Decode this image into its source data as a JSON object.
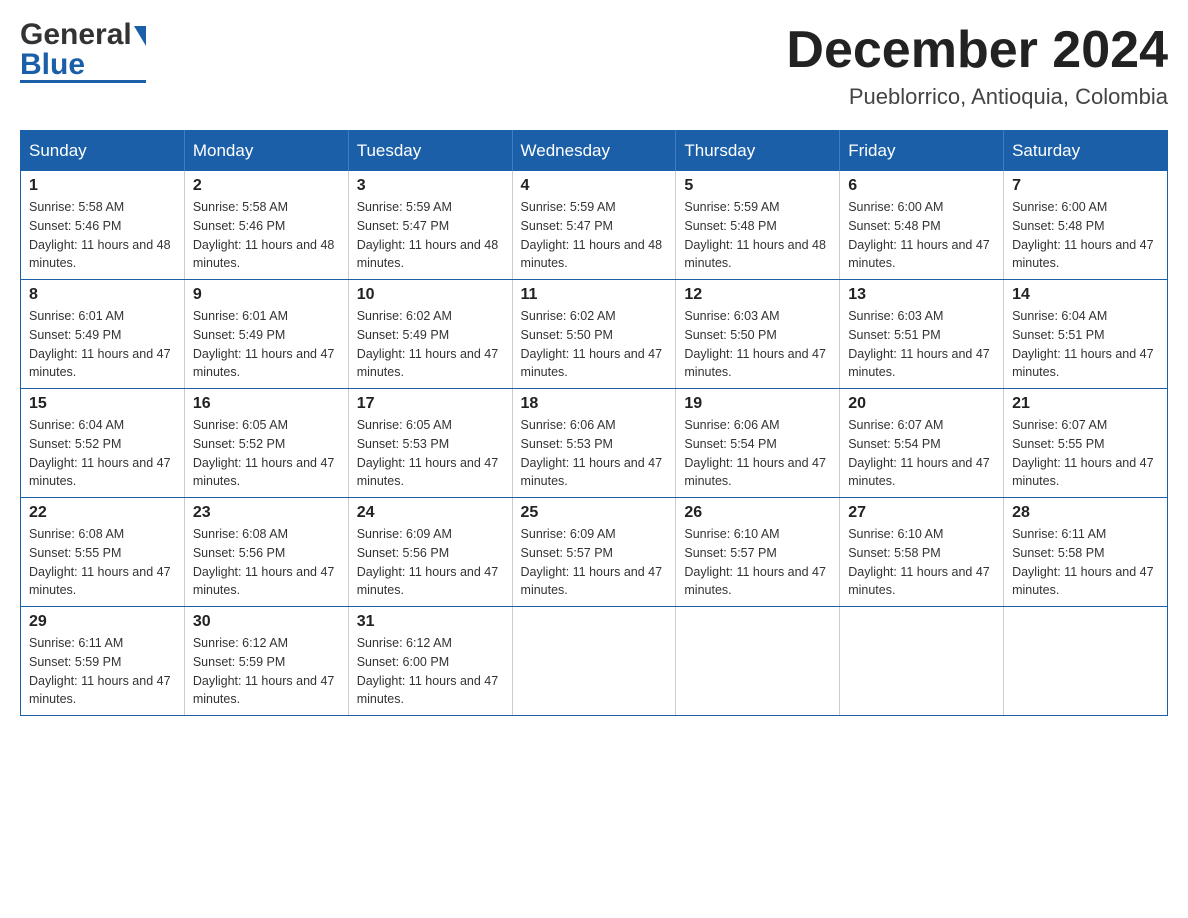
{
  "header": {
    "logo_general": "General",
    "logo_blue": "Blue",
    "month_title": "December 2024",
    "location": "Pueblorrico, Antioquia, Colombia"
  },
  "days_of_week": [
    "Sunday",
    "Monday",
    "Tuesday",
    "Wednesday",
    "Thursday",
    "Friday",
    "Saturday"
  ],
  "weeks": [
    [
      {
        "day": "1",
        "sunrise": "Sunrise: 5:58 AM",
        "sunset": "Sunset: 5:46 PM",
        "daylight": "Daylight: 11 hours and 48 minutes."
      },
      {
        "day": "2",
        "sunrise": "Sunrise: 5:58 AM",
        "sunset": "Sunset: 5:46 PM",
        "daylight": "Daylight: 11 hours and 48 minutes."
      },
      {
        "day": "3",
        "sunrise": "Sunrise: 5:59 AM",
        "sunset": "Sunset: 5:47 PM",
        "daylight": "Daylight: 11 hours and 48 minutes."
      },
      {
        "day": "4",
        "sunrise": "Sunrise: 5:59 AM",
        "sunset": "Sunset: 5:47 PM",
        "daylight": "Daylight: 11 hours and 48 minutes."
      },
      {
        "day": "5",
        "sunrise": "Sunrise: 5:59 AM",
        "sunset": "Sunset: 5:48 PM",
        "daylight": "Daylight: 11 hours and 48 minutes."
      },
      {
        "day": "6",
        "sunrise": "Sunrise: 6:00 AM",
        "sunset": "Sunset: 5:48 PM",
        "daylight": "Daylight: 11 hours and 47 minutes."
      },
      {
        "day": "7",
        "sunrise": "Sunrise: 6:00 AM",
        "sunset": "Sunset: 5:48 PM",
        "daylight": "Daylight: 11 hours and 47 minutes."
      }
    ],
    [
      {
        "day": "8",
        "sunrise": "Sunrise: 6:01 AM",
        "sunset": "Sunset: 5:49 PM",
        "daylight": "Daylight: 11 hours and 47 minutes."
      },
      {
        "day": "9",
        "sunrise": "Sunrise: 6:01 AM",
        "sunset": "Sunset: 5:49 PM",
        "daylight": "Daylight: 11 hours and 47 minutes."
      },
      {
        "day": "10",
        "sunrise": "Sunrise: 6:02 AM",
        "sunset": "Sunset: 5:49 PM",
        "daylight": "Daylight: 11 hours and 47 minutes."
      },
      {
        "day": "11",
        "sunrise": "Sunrise: 6:02 AM",
        "sunset": "Sunset: 5:50 PM",
        "daylight": "Daylight: 11 hours and 47 minutes."
      },
      {
        "day": "12",
        "sunrise": "Sunrise: 6:03 AM",
        "sunset": "Sunset: 5:50 PM",
        "daylight": "Daylight: 11 hours and 47 minutes."
      },
      {
        "day": "13",
        "sunrise": "Sunrise: 6:03 AM",
        "sunset": "Sunset: 5:51 PM",
        "daylight": "Daylight: 11 hours and 47 minutes."
      },
      {
        "day": "14",
        "sunrise": "Sunrise: 6:04 AM",
        "sunset": "Sunset: 5:51 PM",
        "daylight": "Daylight: 11 hours and 47 minutes."
      }
    ],
    [
      {
        "day": "15",
        "sunrise": "Sunrise: 6:04 AM",
        "sunset": "Sunset: 5:52 PM",
        "daylight": "Daylight: 11 hours and 47 minutes."
      },
      {
        "day": "16",
        "sunrise": "Sunrise: 6:05 AM",
        "sunset": "Sunset: 5:52 PM",
        "daylight": "Daylight: 11 hours and 47 minutes."
      },
      {
        "day": "17",
        "sunrise": "Sunrise: 6:05 AM",
        "sunset": "Sunset: 5:53 PM",
        "daylight": "Daylight: 11 hours and 47 minutes."
      },
      {
        "day": "18",
        "sunrise": "Sunrise: 6:06 AM",
        "sunset": "Sunset: 5:53 PM",
        "daylight": "Daylight: 11 hours and 47 minutes."
      },
      {
        "day": "19",
        "sunrise": "Sunrise: 6:06 AM",
        "sunset": "Sunset: 5:54 PM",
        "daylight": "Daylight: 11 hours and 47 minutes."
      },
      {
        "day": "20",
        "sunrise": "Sunrise: 6:07 AM",
        "sunset": "Sunset: 5:54 PM",
        "daylight": "Daylight: 11 hours and 47 minutes."
      },
      {
        "day": "21",
        "sunrise": "Sunrise: 6:07 AM",
        "sunset": "Sunset: 5:55 PM",
        "daylight": "Daylight: 11 hours and 47 minutes."
      }
    ],
    [
      {
        "day": "22",
        "sunrise": "Sunrise: 6:08 AM",
        "sunset": "Sunset: 5:55 PM",
        "daylight": "Daylight: 11 hours and 47 minutes."
      },
      {
        "day": "23",
        "sunrise": "Sunrise: 6:08 AM",
        "sunset": "Sunset: 5:56 PM",
        "daylight": "Daylight: 11 hours and 47 minutes."
      },
      {
        "day": "24",
        "sunrise": "Sunrise: 6:09 AM",
        "sunset": "Sunset: 5:56 PM",
        "daylight": "Daylight: 11 hours and 47 minutes."
      },
      {
        "day": "25",
        "sunrise": "Sunrise: 6:09 AM",
        "sunset": "Sunset: 5:57 PM",
        "daylight": "Daylight: 11 hours and 47 minutes."
      },
      {
        "day": "26",
        "sunrise": "Sunrise: 6:10 AM",
        "sunset": "Sunset: 5:57 PM",
        "daylight": "Daylight: 11 hours and 47 minutes."
      },
      {
        "day": "27",
        "sunrise": "Sunrise: 6:10 AM",
        "sunset": "Sunset: 5:58 PM",
        "daylight": "Daylight: 11 hours and 47 minutes."
      },
      {
        "day": "28",
        "sunrise": "Sunrise: 6:11 AM",
        "sunset": "Sunset: 5:58 PM",
        "daylight": "Daylight: 11 hours and 47 minutes."
      }
    ],
    [
      {
        "day": "29",
        "sunrise": "Sunrise: 6:11 AM",
        "sunset": "Sunset: 5:59 PM",
        "daylight": "Daylight: 11 hours and 47 minutes."
      },
      {
        "day": "30",
        "sunrise": "Sunrise: 6:12 AM",
        "sunset": "Sunset: 5:59 PM",
        "daylight": "Daylight: 11 hours and 47 minutes."
      },
      {
        "day": "31",
        "sunrise": "Sunrise: 6:12 AM",
        "sunset": "Sunset: 6:00 PM",
        "daylight": "Daylight: 11 hours and 47 minutes."
      },
      null,
      null,
      null,
      null
    ]
  ]
}
